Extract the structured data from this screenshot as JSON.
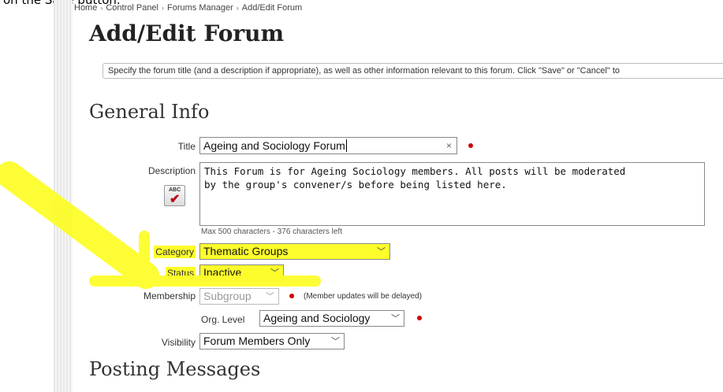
{
  "caption": "on the Save button.",
  "breadcrumb": {
    "items": [
      "Home",
      "Control Panel",
      "Forums Manager",
      "Add/Edit Forum"
    ],
    "separator": "›"
  },
  "page_title": "Add/Edit Forum",
  "info_text": "Specify the forum title (and a description if appropriate), as well as other information relevant to this forum. Click \"Save\" or \"Cancel\" to",
  "sections": {
    "general_info": "General Info",
    "posting_messages": "Posting Messages"
  },
  "form": {
    "title": {
      "label": "Title",
      "value": "Ageing and Sociology Forum",
      "clear": "×"
    },
    "description": {
      "label": "Description",
      "value": "This Forum is for Ageing Sociology members. All posts will be moderated\nby the group's convener/s before being listed here.",
      "spellcheck_icon_text": "ABC",
      "hint": "Max 500 characters - 376 characters left"
    },
    "category": {
      "label": "Category",
      "value": "Thematic Groups"
    },
    "status": {
      "label": "Status",
      "value": "Inactive"
    },
    "membership": {
      "label": "Membership",
      "value": "Subgroup",
      "note": "(Member updates will be delayed)"
    },
    "org_level": {
      "label": "Org. Level",
      "value": "Ageing and Sociology"
    },
    "visibility": {
      "label": "Visibility",
      "value": "Forum Members Only"
    }
  },
  "icons": {
    "chevron": "chevron-down-icon",
    "required": "required-dot-icon",
    "spellcheck": "spellcheck-icon",
    "annotation": "yellow-arrow-annotation"
  },
  "colors": {
    "highlight": "#fdfd2b",
    "required": "#d00000"
  }
}
